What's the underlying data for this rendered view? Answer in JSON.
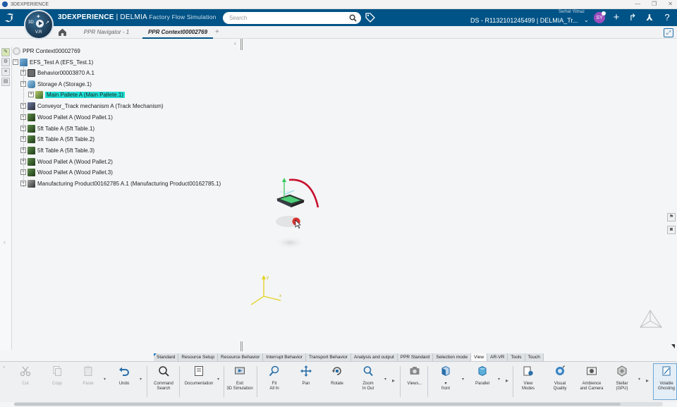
{
  "os": {
    "title": "3DEXPERIENCE"
  },
  "header": {
    "brand_strong": "3DEXPERIENCE",
    "brand_sep": " | DELMIA ",
    "brand_sub": "Factory Flow Simulation",
    "search_placeholder": "Search",
    "user_name": "Serhat Yilmaz",
    "context": "DS - R1132101245499 | DELMIA_Tr...",
    "avatar_initials": "SY",
    "compass_vr": "V.R",
    "compass_3d": "3D"
  },
  "tabs": {
    "navigator": "PPR Navigator - 1",
    "context": "PPR Context00002769",
    "add": "+"
  },
  "tree": {
    "root": "PPR Context00002769",
    "product": "EFS_Test A (EFS_Test.1)",
    "items": [
      "Behavior00003870 A.1",
      "Storage A (Storage.1)",
      "Main Pallete A (Main Pallete.1)",
      "Conveyor_Track mechanism A (Track Mechanism)",
      "Wood Pallet A (Wood Pallet.1)",
      "5ft Table A (5ft Table.1)",
      "5ft Table A (5ft Table.2)",
      "5ft Table A (5ft Table.3)",
      "Wood Pallet A (Wood Pallet.2)",
      "Wood Pallet A (Wood Pallet.3)",
      "Manufacturing Product00162785 A.1 (Manufacturing Product00162785.1)"
    ]
  },
  "scene": {
    "axis_x": "x",
    "axis_y": "y"
  },
  "action_tabs": [
    "Standard",
    "Resource Setup",
    "Resource Behavior",
    "Interrupt Behavior",
    "Transport Behavior",
    "Analysis and output",
    "PPR Standard",
    "Selection mode",
    "View",
    "AR-VR",
    "Tools",
    "Touch"
  ],
  "tools": {
    "cut": "Cut",
    "copy": "Copy",
    "paste": "Paste",
    "undo": "Undo",
    "command_search_1": "Command",
    "command_search_2": "Search",
    "documentation": "Documentation",
    "exit_sim_1": "Exit",
    "exit_sim_2": "3D Simulation",
    "fit_all_1": "Fit",
    "fit_all_2": "All In",
    "pan": "Pan",
    "rotate": "Rotate",
    "zoom_1": "Zoom",
    "zoom_2": "In Out",
    "views": "Views...",
    "front": "front",
    "parallel": "Parallel",
    "view_modes_1": "View",
    "view_modes_2": "Modes",
    "visual_quality_1": "Visual",
    "visual_quality_2": "Quality",
    "ambience_1": "Ambience",
    "ambience_2": "and Camera",
    "stellar_1": "Stellar",
    "stellar_2": "(GPU)",
    "volatile_1": "Volatile",
    "volatile_2": "Ghosting"
  },
  "colors": {
    "header_bg": "#005386",
    "selection": "#1ee0d6",
    "active_tab_underline": "#005386",
    "manipulator_arc": "#c8102e",
    "axis_yellow": "#e3d21c"
  }
}
